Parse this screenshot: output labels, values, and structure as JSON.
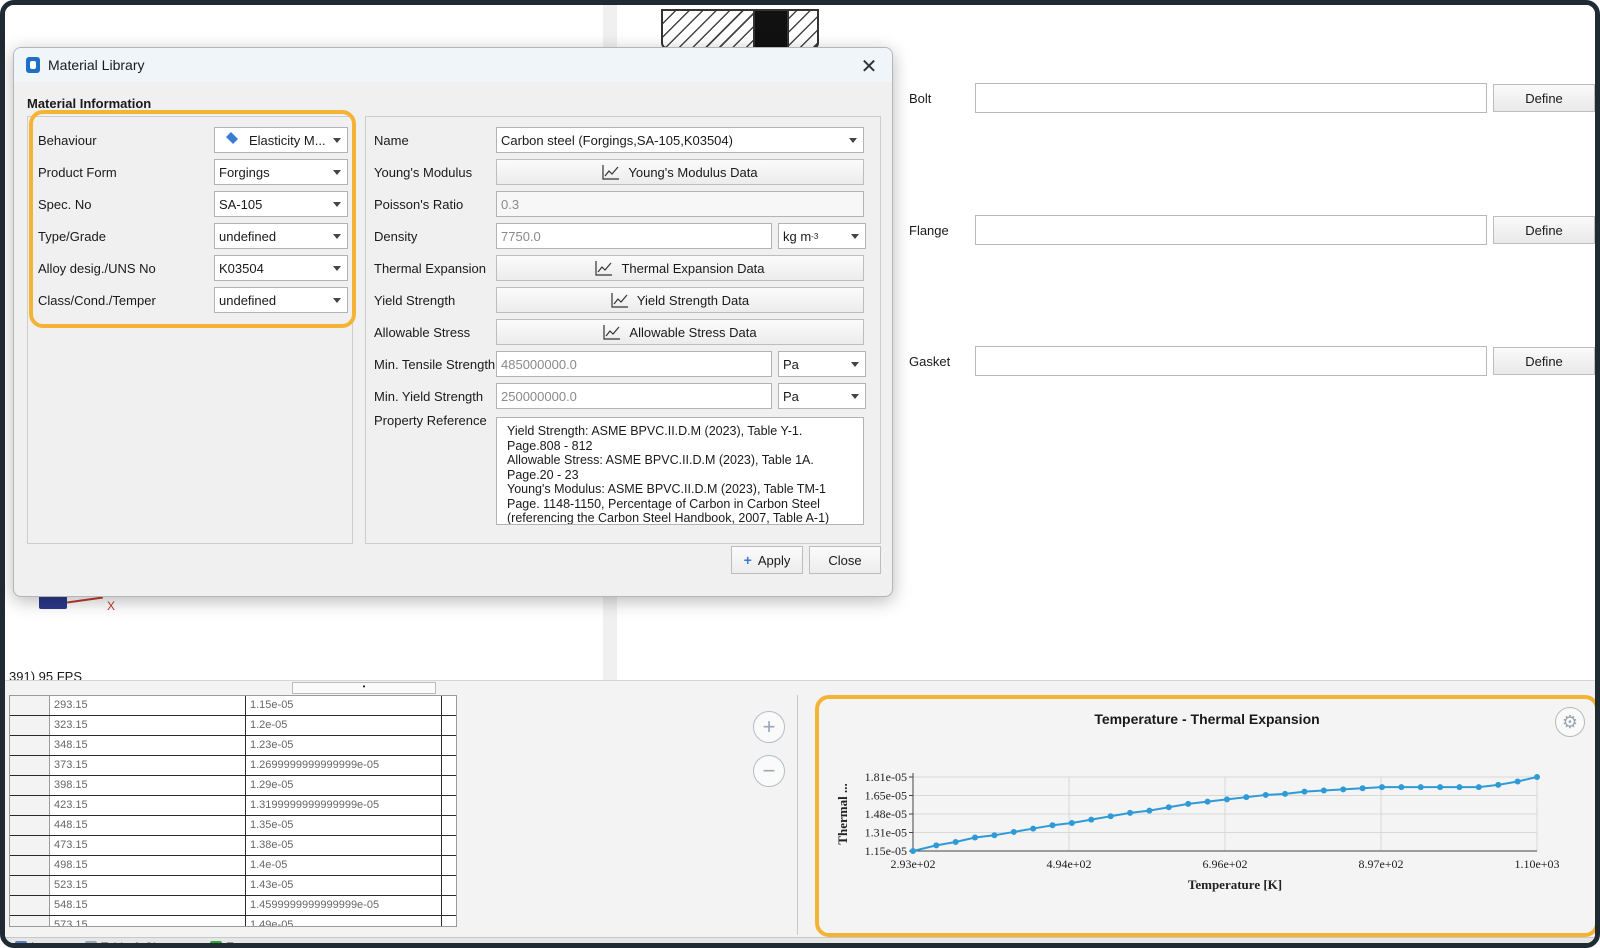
{
  "dialog": {
    "title": "Material Library",
    "section_title": "Material Information",
    "left": {
      "behaviour": {
        "label": "Behaviour",
        "value": "Elasticity M..."
      },
      "product_form": {
        "label": "Product Form",
        "value": "Forgings"
      },
      "spec_no": {
        "label": "Spec. No",
        "value": "SA-105"
      },
      "type_grade": {
        "label": "Type/Grade",
        "value": "undefined"
      },
      "alloy": {
        "label": "Alloy desig./UNS No",
        "value": "K03504"
      },
      "class": {
        "label": "Class/Cond./Temper",
        "value": "undefined"
      }
    },
    "right": {
      "name": {
        "label": "Name",
        "value": "Carbon steel (Forgings,SA-105,K03504)"
      },
      "youngs": {
        "label": "Young's Modulus",
        "button": "Young's Modulus Data"
      },
      "poisson": {
        "label": "Poisson's Ratio",
        "value": "0.3"
      },
      "density": {
        "label": "Density",
        "value": "7750.0",
        "unit": "kg m",
        "unit_sup": "-3"
      },
      "thermal": {
        "label": "Thermal Expansion",
        "button": "Thermal Expansion Data"
      },
      "yield": {
        "label": "Yield Strength",
        "button": "Yield Strength Data"
      },
      "allowable": {
        "label": "Allowable Stress",
        "button": "Allowable Stress Data"
      },
      "min_tensile": {
        "label": "Min. Tensile Strength",
        "value": "485000000.0",
        "unit": "Pa"
      },
      "min_yield": {
        "label": "Min. Yield Strength",
        "value": "250000000.0",
        "unit": "Pa"
      },
      "reference": {
        "label": "Property Reference",
        "lines": [
          "Yield Strength: ASME BPVC.II.D.M (2023), Table Y-1. Page.808 - 812",
          "Allowable Stress: ASME BPVC.II.D.M (2023), Table 1A. Page.20 - 23",
          "Young's Modulus: ASME BPVC.II.D.M (2023), Table TM-1 Page. 1148-1150, Percentage of Carbon in Carbon Steel (referencing the Carbon Steel Handbook, 2007, Table A-1)"
        ]
      }
    },
    "apply_label": "Apply",
    "close_label": "Close"
  },
  "background": {
    "bolt_label": "Bolt",
    "flange_label": "Flange",
    "gasket_label": "Gasket",
    "define_label": "Define",
    "axis_x_label": "X",
    "fps_text": "391) 95 FPS"
  },
  "table": {
    "rows": [
      [
        "293.15",
        "1.15e-05"
      ],
      [
        "323.15",
        "1.2e-05"
      ],
      [
        "348.15",
        "1.23e-05"
      ],
      [
        "373.15",
        "1.2699999999999999e-05"
      ],
      [
        "398.15",
        "1.29e-05"
      ],
      [
        "423.15",
        "1.3199999999999999e-05"
      ],
      [
        "448.15",
        "1.35e-05"
      ],
      [
        "473.15",
        "1.38e-05"
      ],
      [
        "498.15",
        "1.4e-05"
      ],
      [
        "523.15",
        "1.43e-05"
      ],
      [
        "548.15",
        "1.4599999999999999e-05"
      ],
      [
        "573.15",
        "1.49e-05"
      ]
    ]
  },
  "status_tabs": {
    "logs": "Logs",
    "table_chart": "Table & Chart",
    "errors": "Errors"
  },
  "colors": {
    "highlight": "#f5b335",
    "series": "#2e9bd6"
  },
  "chart_data": {
    "type": "line",
    "title": "Temperature - Thermal Expansion",
    "xlabel": "Temperature [K]",
    "ylabel": "Thermal ...",
    "x_ticks": [
      "2.93e+02",
      "4.94e+02",
      "6.96e+02",
      "8.97e+02",
      "1.10e+03"
    ],
    "y_ticks": [
      "1.15e-05",
      "1.31e-05",
      "1.48e-05",
      "1.65e-05",
      "1.81e-05"
    ],
    "xlim": [
      293.15,
      1098.15
    ],
    "ylim": [
      1.15e-05,
      1.81e-05
    ],
    "x": [
      293.15,
      323.15,
      348.15,
      373.15,
      398.15,
      423.15,
      448.15,
      473.15,
      498.15,
      523.15,
      548.15,
      573.15,
      598.15,
      623.15,
      648.15,
      673.15,
      698.15,
      723.15,
      748.15,
      773.15,
      798.15,
      823.15,
      848.15,
      873.15,
      898.15,
      923.15,
      948.15,
      973.15,
      998.15,
      1023.15,
      1048.15,
      1073.15,
      1098.15
    ],
    "y": [
      1.15e-05,
      1.2e-05,
      1.23e-05,
      1.27e-05,
      1.29e-05,
      1.32e-05,
      1.35e-05,
      1.38e-05,
      1.4e-05,
      1.43e-05,
      1.46e-05,
      1.49e-05,
      1.51e-05,
      1.54e-05,
      1.57e-05,
      1.59e-05,
      1.61e-05,
      1.63e-05,
      1.65e-05,
      1.66e-05,
      1.68e-05,
      1.69e-05,
      1.7e-05,
      1.71e-05,
      1.72e-05,
      1.72e-05,
      1.72e-05,
      1.72e-05,
      1.72e-05,
      1.72e-05,
      1.74e-05,
      1.77e-05,
      1.81e-05
    ],
    "grid": true,
    "legend": "none"
  }
}
